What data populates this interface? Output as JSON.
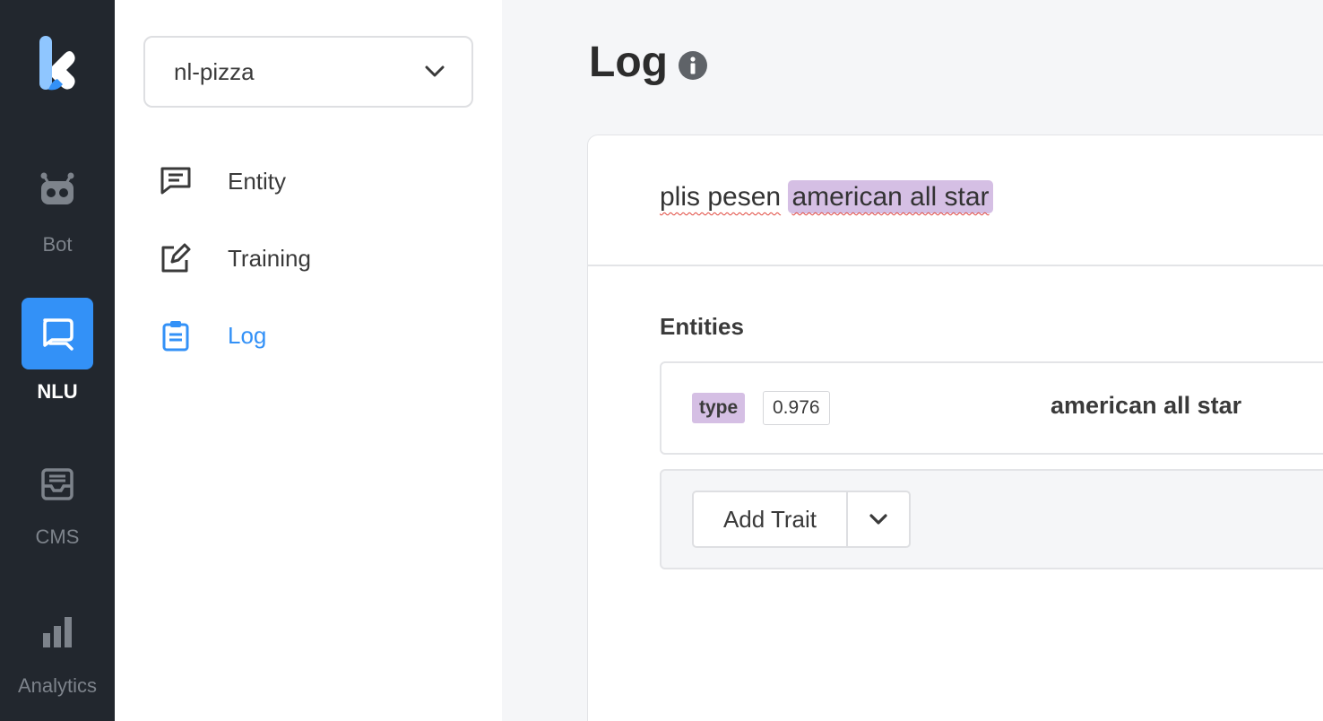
{
  "rail": {
    "items": [
      {
        "label": "Bot",
        "icon": "robot-icon"
      },
      {
        "label": "NLU",
        "icon": "chat-bubbles-icon",
        "active": true
      },
      {
        "label": "CMS",
        "icon": "inbox-tray-icon"
      },
      {
        "label": "Analytics",
        "icon": "bar-chart-icon"
      }
    ]
  },
  "sidebar": {
    "project": "nl-pizza",
    "items": [
      {
        "label": "Entity",
        "icon": "message-square-icon"
      },
      {
        "label": "Training",
        "icon": "edit-pencil-icon"
      },
      {
        "label": "Log",
        "icon": "clipboard-icon",
        "active": true
      }
    ]
  },
  "main": {
    "title": "Log",
    "utterance": {
      "plain": "plis pesen",
      "entity_text": "american all star"
    },
    "entities_heading": "Entities",
    "entities": [
      {
        "type": "type",
        "confidence": "0.976",
        "value": "american all star"
      }
    ],
    "add_trait_label": "Add Trait"
  },
  "colors": {
    "accent": "#3391f7",
    "rail_bg": "#22272e",
    "entity_highlight": "#d5bfe4"
  }
}
